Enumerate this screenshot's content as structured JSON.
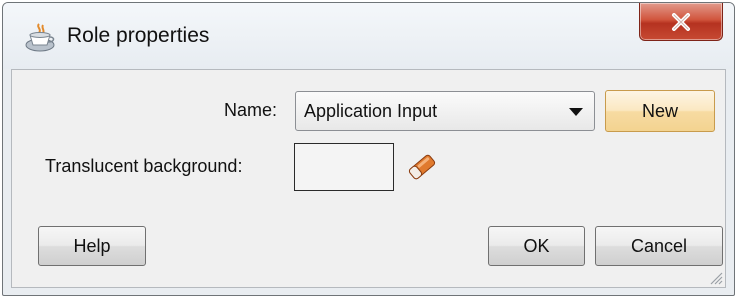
{
  "window": {
    "title": "Role properties",
    "close_glyph": "X",
    "icon": "coffee-cup-icon"
  },
  "form": {
    "name_label": "Name:",
    "name_value": "Application Input",
    "new_button_label": "New",
    "translucent_label": "Translucent background:",
    "translucent_color": "#f4f4f4",
    "eraser_icon": "eraser-icon"
  },
  "footer": {
    "help_label": "Help",
    "ok_label": "OK",
    "cancel_label": "Cancel"
  },
  "colors": {
    "close_button": "#c74a33",
    "new_button": "#fbe8c2",
    "eraser": "#e07a2e"
  }
}
